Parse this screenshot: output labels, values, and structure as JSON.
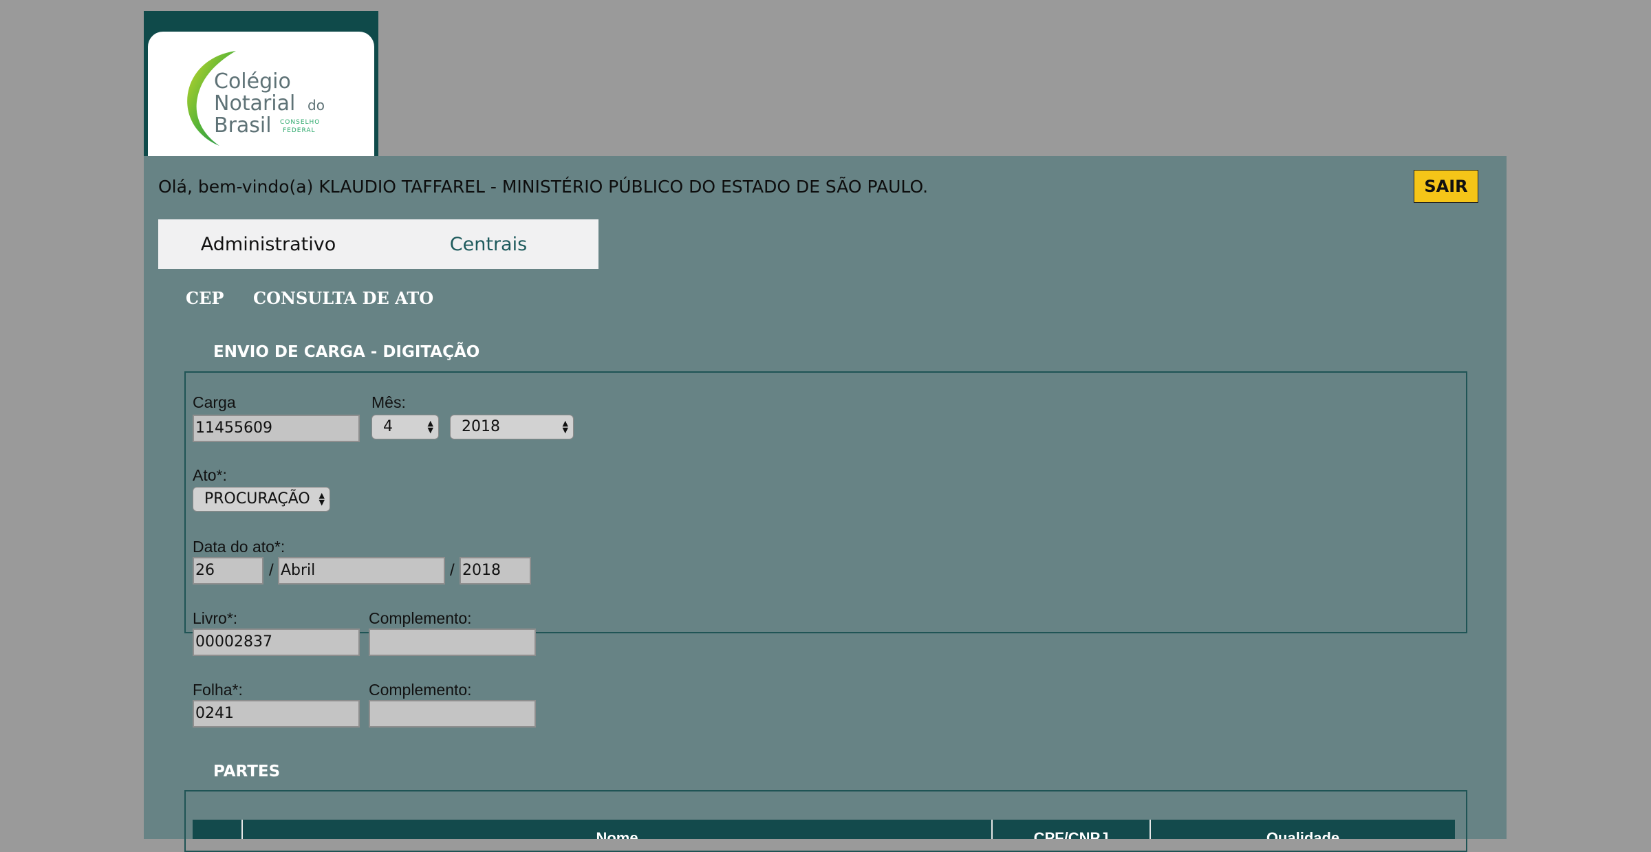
{
  "logo": {
    "line1": "Colégio",
    "line2": "Notarial",
    "line2_small": "do",
    "line3": "Brasil",
    "tag1": "CONSELHO",
    "tag2": "FEDERAL"
  },
  "header": {
    "welcome": "Olá, bem-vindo(a) KLAUDIO TAFFAREL - MINISTÉRIO PÚBLICO DO ESTADO DE SÃO PAULO.",
    "logout_label": "SAIR"
  },
  "tabs": [
    {
      "label": "Administrativo"
    },
    {
      "label": "Centrais"
    }
  ],
  "subnav": [
    {
      "label": "CEP"
    },
    {
      "label": "CONSULTA DE ATO"
    }
  ],
  "form": {
    "title": "ENVIO DE CARGA - DIGITAÇÃO",
    "carga_label": "Carga",
    "carga_value": "11455609",
    "mes_label": "Mês:",
    "mes_value": "4",
    "ano_value": "2018",
    "ato_label": "Ato*:",
    "ato_value": "PROCURAÇÃO",
    "data_label": "Data do ato*:",
    "data_dia": "26",
    "data_mes": "Abril",
    "data_ano": "2018",
    "separator": "/",
    "livro_label": "Livro*:",
    "livro_value": "00002837",
    "livro_complemento_label": "Complemento:",
    "livro_complemento_value": "",
    "folha_label": "Folha*:",
    "folha_value": "0241",
    "folha_complemento_label": "Complemento:",
    "folha_complemento_value": ""
  },
  "partes": {
    "title": "PARTES",
    "columns": [
      "",
      "Nome",
      "CPF/CNPJ",
      "Qualidade"
    ]
  },
  "colors": {
    "page_bg": "#9a9a9a",
    "panel_bg": "#678385",
    "accent_dark": "#134a4c",
    "logout_bg": "#f5c518",
    "input_bg": "#c4c4c4"
  }
}
